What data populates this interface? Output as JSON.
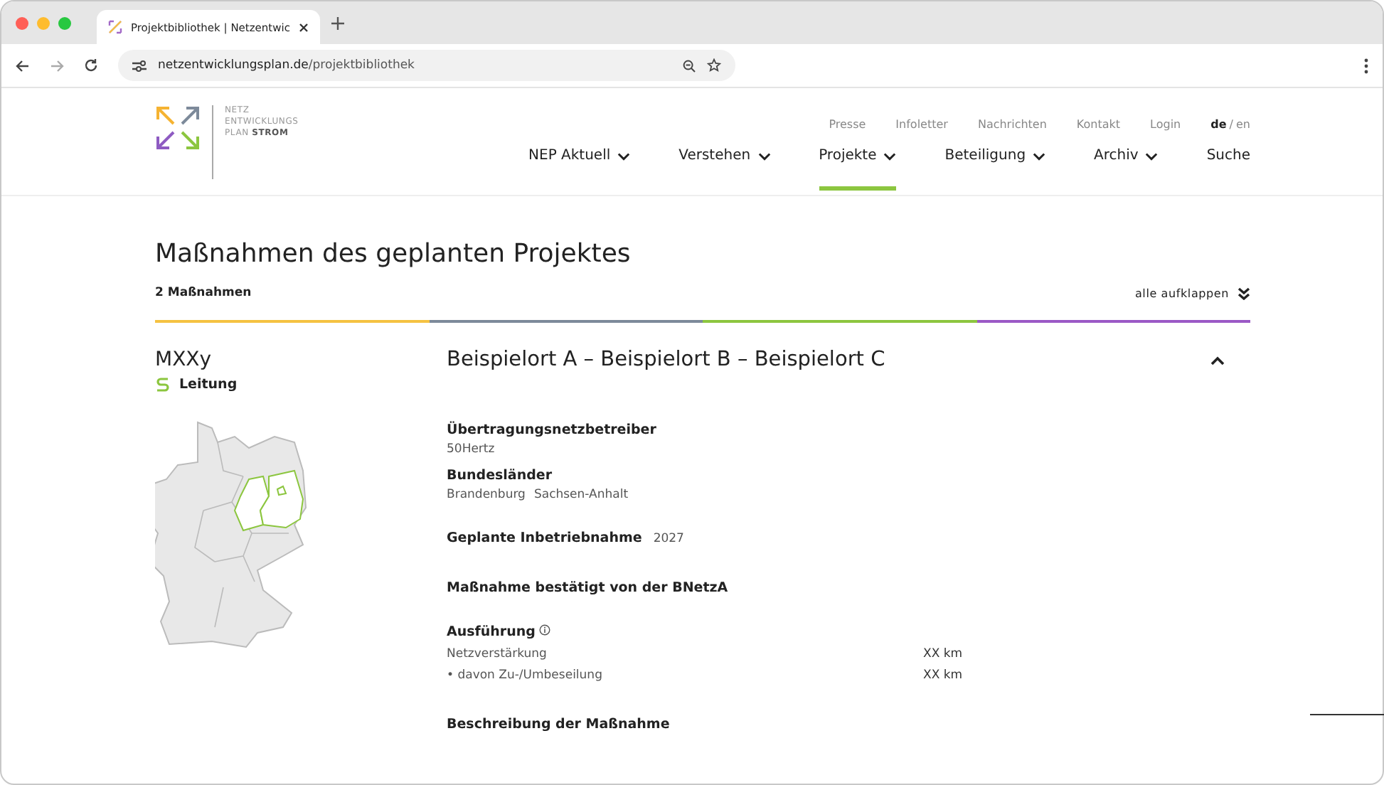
{
  "browser": {
    "tab_title": "Projektbibliothek | Netzentwic",
    "url_host": "netzentwicklungsplan.de",
    "url_path": "/projektbibliothek"
  },
  "header": {
    "logo_lines": [
      "NETZ",
      "ENTWICKLUNGS"
    ],
    "logo_last_plain": "PLAN ",
    "logo_last_bold": "STROM",
    "top_links": [
      "Presse",
      "Infoletter",
      "Nachrichten",
      "Kontakt",
      "Login"
    ],
    "language_separator": "/",
    "languages": [
      {
        "label": "de",
        "selected": true
      },
      {
        "label": "en",
        "selected": false
      }
    ],
    "nav": [
      {
        "label": "NEP Aktuell",
        "dropdown": true,
        "selected": false
      },
      {
        "label": "Verstehen",
        "dropdown": true,
        "selected": false
      },
      {
        "label": "Projekte",
        "dropdown": true,
        "selected": true
      },
      {
        "label": "Beteiligung",
        "dropdown": true,
        "selected": false
      },
      {
        "label": "Archiv",
        "dropdown": true,
        "selected": false
      },
      {
        "label": "Suche",
        "dropdown": false,
        "selected": false
      }
    ]
  },
  "section": {
    "title": "Maßnahmen des geplanten Projektes",
    "count": "2 Maßnahmen",
    "expand_all": "alle aufklappen",
    "divider_segments": [
      {
        "color": "#f5c242"
      },
      {
        "color": "#7d8a9a"
      },
      {
        "color": "#8cc63f"
      },
      {
        "color": "#9b59c6"
      }
    ]
  },
  "measure": {
    "code": "MXXy",
    "type": "Leitung",
    "title": "Beispielort A – Beispielort B – Beispielort C",
    "expanded": true,
    "operator_label": "Übertragungsnetzbetreiber",
    "operator": "50Hertz",
    "states_label": "Bundesländer",
    "states": [
      "Brandenburg",
      "Sachsen-Anhalt"
    ],
    "commissioning_label": "Geplante Inbetriebnahme",
    "commissioning": "2027",
    "confirmed": "Maßnahme bestätigt von der BNetzA",
    "execution_label": "Ausführung",
    "execution_rows": [
      {
        "label": "Netzverstärkung",
        "value": "XX km"
      },
      {
        "label": "• davon Zu-/Umbeseilung",
        "value": "XX km"
      }
    ],
    "description_label": "Beschreibung der Maßnahme"
  }
}
